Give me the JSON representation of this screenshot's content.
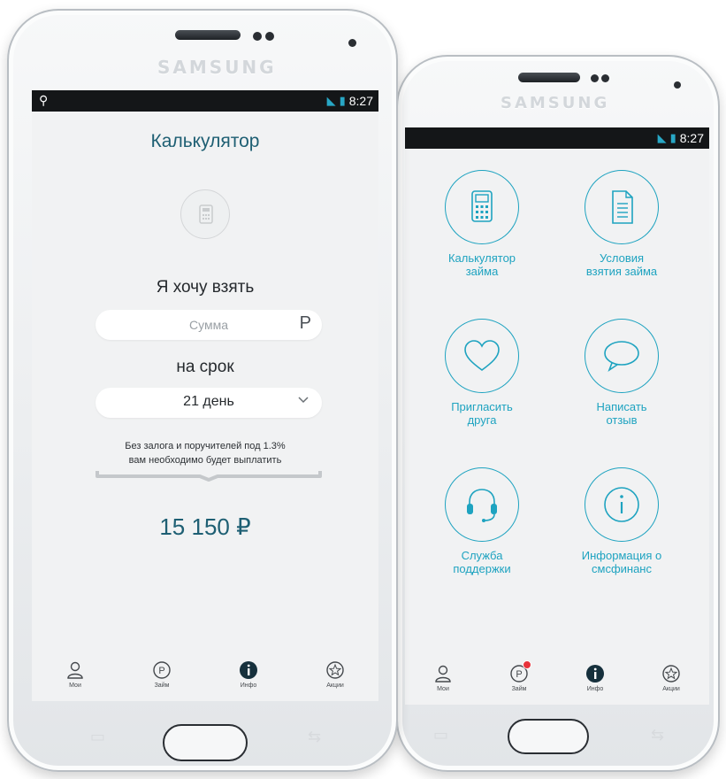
{
  "brand": "SAMSUNG",
  "status": {
    "time": "8:27"
  },
  "calculator": {
    "title": "Калькулятор",
    "want_label": "Я хочу взять",
    "amount_placeholder": "Сумма",
    "currency_suffix": "Р",
    "term_label": "на срок",
    "term_value": "21 день",
    "note_line1": "Без залога и поручителей под 1.3%",
    "note_line2": "вам необходимо будет выплатить",
    "result": "15 150 ₽"
  },
  "menu": {
    "items": [
      {
        "label": "Калькулятор\nзайма",
        "icon": "calculator-icon"
      },
      {
        "label": "Условия\nвзятия займа",
        "icon": "document-icon"
      },
      {
        "label": "Пригласить\nдруга",
        "icon": "heart-icon"
      },
      {
        "label": "Написать\nотзыв",
        "icon": "chat-bubble-icon"
      },
      {
        "label": "Служба\nподдержки",
        "icon": "headset-icon"
      },
      {
        "label": "Информация о\nсмсфинанс",
        "icon": "info-icon"
      }
    ]
  },
  "tabs": [
    {
      "label": "Мои",
      "icon": "user-icon"
    },
    {
      "label": "Займ",
      "icon": "loan-p-icon"
    },
    {
      "label": "Инфо",
      "icon": "info-filled-icon"
    },
    {
      "label": "Акции",
      "icon": "star-badge-icon"
    }
  ],
  "colors": {
    "accent": "#1ea3c0",
    "title": "#1e5f73",
    "badge": "#e8333b",
    "statusbar": "#141618"
  }
}
